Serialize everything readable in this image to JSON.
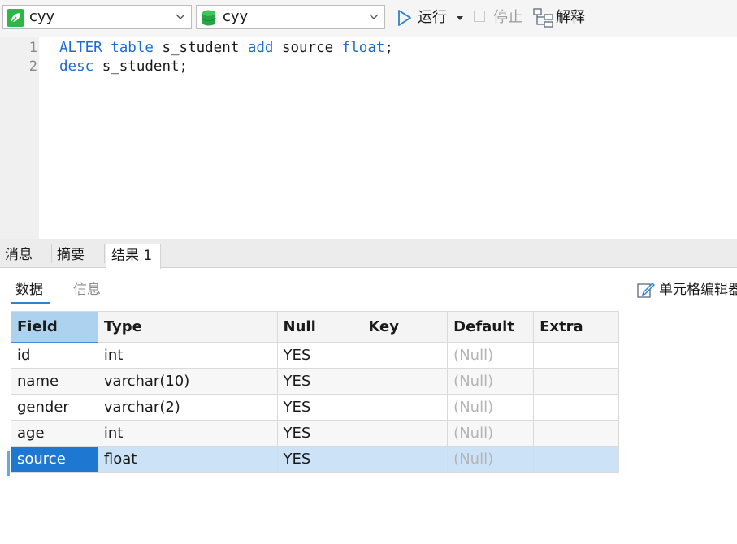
{
  "toolbar": {
    "connection": {
      "value": "cyy",
      "icon": "connection-leaf-icon",
      "color": "#2fb54a"
    },
    "database": {
      "value": "cyy",
      "icon": "database-icon",
      "color": "#2fb54a"
    },
    "run_label": "运行",
    "stop_label": "停止",
    "explain_label": "解释"
  },
  "editor": {
    "lines": [
      {
        "number": "1",
        "tokens": [
          "ALTER",
          " ",
          "table",
          " s_student ",
          "add",
          " source ",
          "float",
          ";"
        ]
      },
      {
        "number": "2",
        "tokens": [
          "desc",
          " s_student;"
        ]
      }
    ]
  },
  "result_tabs": [
    {
      "label": "消息",
      "active": false
    },
    {
      "label": "摘要",
      "active": false
    },
    {
      "label": "结果 1",
      "active": true
    }
  ],
  "sub_tabs": {
    "data": "数据",
    "info": "信息"
  },
  "cell_editor_label": "单元格编辑器",
  "grid": {
    "columns": [
      "Field",
      "Type",
      "Null",
      "Key",
      "Default",
      "Extra"
    ],
    "rows": [
      [
        "id",
        "int",
        "YES",
        "",
        "(Null)",
        ""
      ],
      [
        "name",
        "varchar(10)",
        "YES",
        "",
        "(Null)",
        ""
      ],
      [
        "gender",
        "varchar(2)",
        "YES",
        "",
        "(Null)",
        ""
      ],
      [
        "age",
        "int",
        "YES",
        "",
        "(Null)",
        ""
      ],
      [
        "source",
        "float",
        "YES",
        "",
        "(Null)",
        ""
      ]
    ],
    "selected_row": 4
  },
  "colors": {
    "keyword": "#1c6cd2",
    "accent": "#2a82d4",
    "selection": "#cce3f7"
  }
}
